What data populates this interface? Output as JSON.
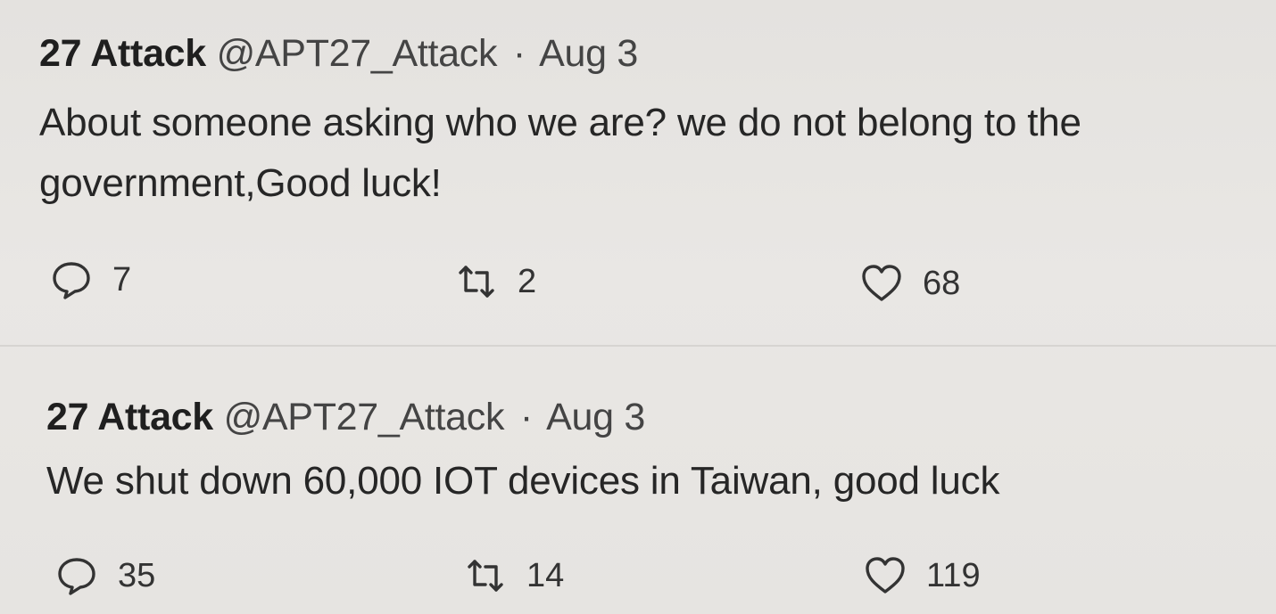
{
  "tweets": [
    {
      "display_name": "27 Attack",
      "handle": "@APT27_Attack",
      "separator": "·",
      "date": "Aug 3",
      "text": "About someone asking who we are? we do not belong to the government,Good luck!",
      "replies": "7",
      "retweets": "2",
      "likes": "68"
    },
    {
      "display_name": "27 Attack",
      "handle": "@APT27_Attack",
      "separator": "·",
      "date": "Aug 3",
      "text": "We shut down 60,000 IOT devices in Taiwan, good luck",
      "replies": "35",
      "retweets": "14",
      "likes": "119"
    }
  ],
  "icons": {
    "reply": "reply-icon",
    "retweet": "retweet-icon",
    "like": "heart-icon"
  },
  "colors": {
    "background": "#e6e4e1",
    "text": "#2b2b2b",
    "icon": "#333333"
  }
}
